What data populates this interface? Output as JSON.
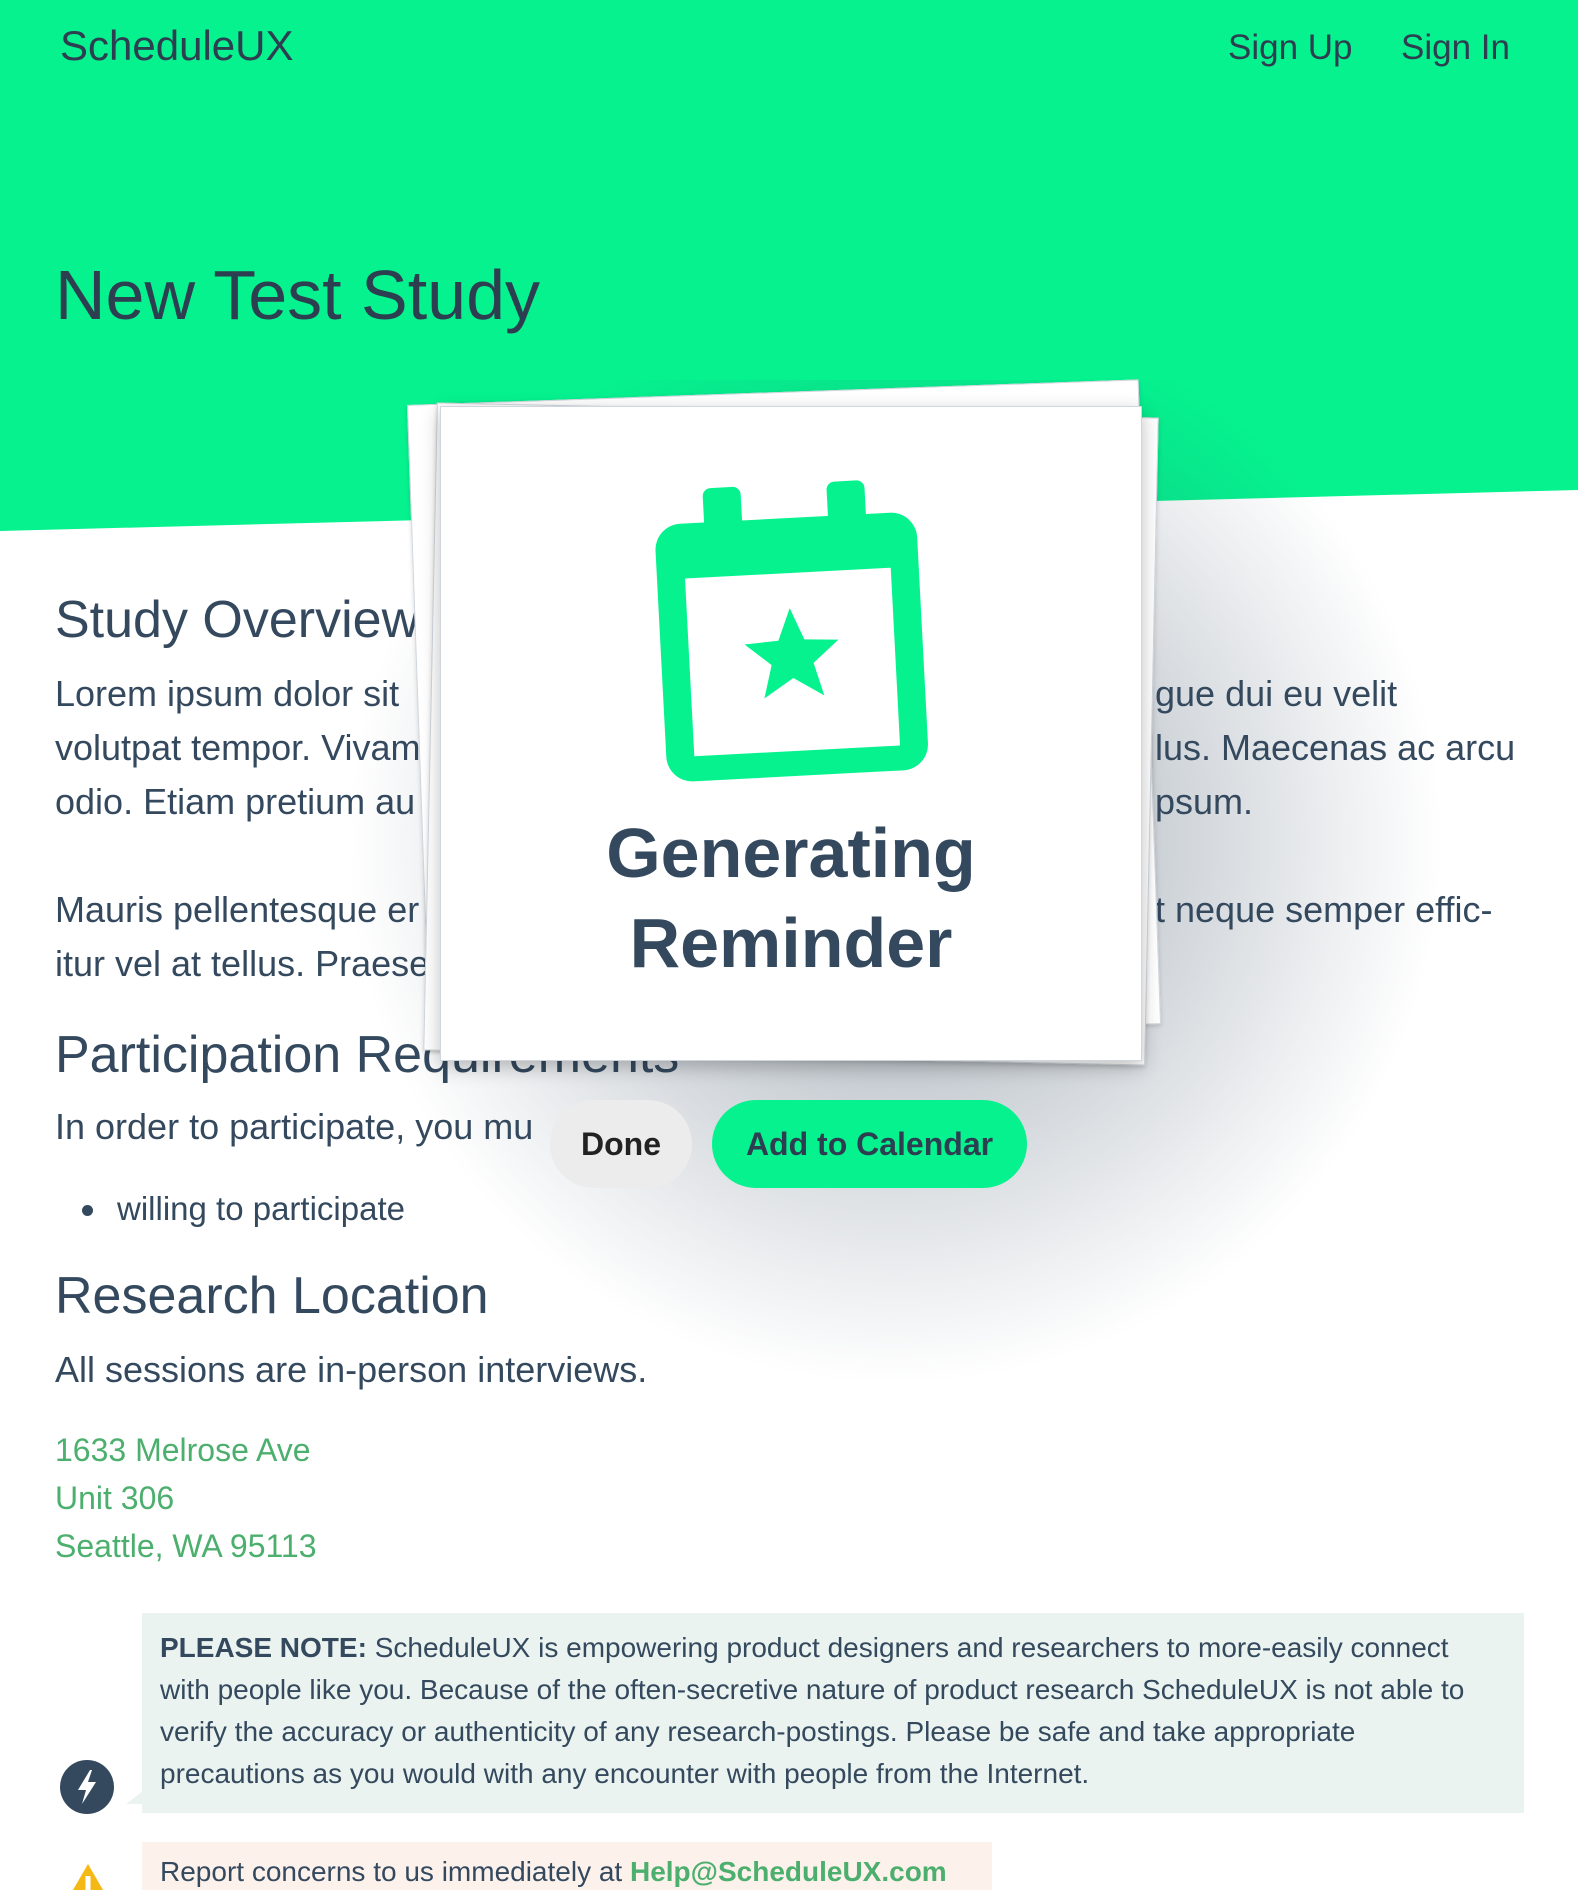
{
  "brand": "ScheduleUX",
  "nav": {
    "signup": "Sign Up",
    "signin": "Sign In"
  },
  "page_title": "New Test Study",
  "overview": {
    "heading": "Study Overview",
    "lines": [
      "Lorem ipsum dolor sit",
      "volutpat tempor. Vivam",
      "odio. Etiam pretium au"
    ],
    "lines_right": [
      "gue dui eu velit",
      "lus. Maecenas ac arcu",
      "psum."
    ],
    "para2_lines": [
      "Mauris pellentesque er",
      "itur vel at tellus. Praese"
    ],
    "para2_right": [
      "t neque semper effic-"
    ]
  },
  "participation": {
    "heading": "Participation Requirements",
    "intro": "In order to participate, you mu",
    "items": [
      "willing to participate"
    ]
  },
  "location": {
    "heading": "Research Location",
    "text": "All sessions are in-person interviews.",
    "address": [
      "1633 Melrose Ave",
      "Unit 306",
      "Seattle, WA 95113"
    ]
  },
  "note": {
    "label": "PLEASE NOTE:",
    "text": " ScheduleUX is empowering product designers and researchers to more-easily connect with people like you. Because of the often-secretive nature of product research ScheduleUX is not able to verify the accuracy or authenticity of any research-postings. Please be safe and take appropriate precautions as you would with any encounter with people from the Internet."
  },
  "report": {
    "text": "Report concerns to us immediately at ",
    "email": "Help@ScheduleUX.com"
  },
  "modal": {
    "title_line1": "Generating",
    "title_line2": "Reminder",
    "done": "Done",
    "add": "Add to Calendar",
    "icon": "calendar-star-icon"
  },
  "colors": {
    "accent": "#05f28f",
    "text": "#34495e",
    "link": "#4caf6e",
    "note_bg": "#eaf3ef",
    "report_bg": "#fdf1ec"
  }
}
